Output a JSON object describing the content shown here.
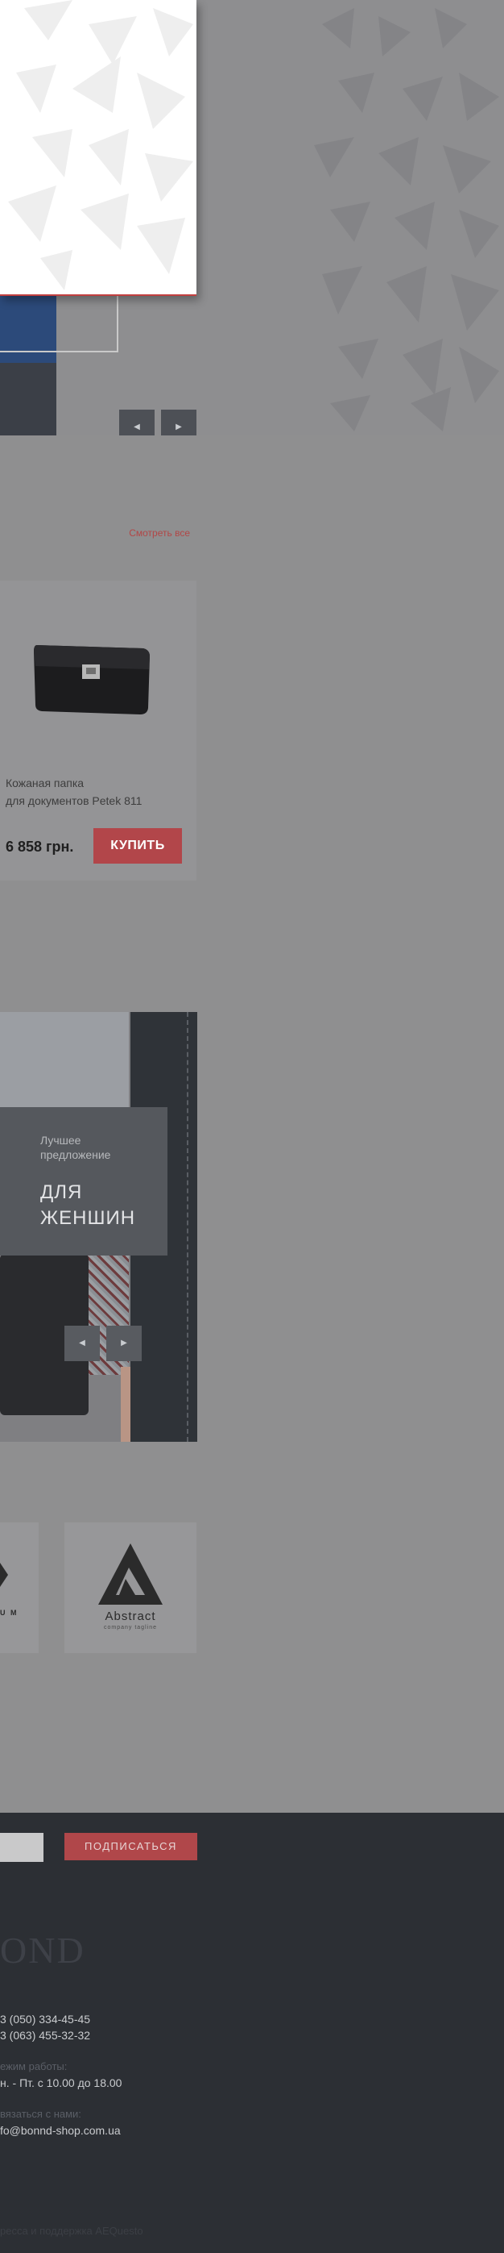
{
  "hero": {
    "prev_arrow": "◀",
    "next_arrow": "▶"
  },
  "products": {
    "see_all_label": "Смотреть все",
    "items": [
      {
        "name_line1": "Кожаная папка",
        "name_line2": "для документов Petek 811",
        "price": "6 858 грн.",
        "buy_label": "КУПИТЬ"
      }
    ]
  },
  "promo": {
    "kicker_line1": "Лучшее",
    "kicker_line2": "предложение",
    "title_line1": "ДЛЯ",
    "title_line2": "ЖЕНШИН",
    "prev_arrow": "◀",
    "next_arrow": "▶"
  },
  "brands": {
    "left_tile_label": "U M",
    "right_tile_name": "Abstract",
    "right_tile_tagline": "company tagline"
  },
  "footer": {
    "subscribe_label": "ПОДПИСАТЬСЯ",
    "logo_text": "OND",
    "phone1": "3 (050) 334-45-45",
    "phone2": "3 (063) 455-32-32",
    "hours_label": "ежим работы:",
    "hours_value": "н. - Пт. с 10.00 до 18.00",
    "contact_label": "вязаться с нами:",
    "email": "fo@bonnd-shop.com.ua",
    "copyright": "ресса и поддержка AEQuesto"
  },
  "colors": {
    "accent": "#b2464a",
    "dark": "#2c2f34",
    "page_bg": "#8f8f90"
  }
}
